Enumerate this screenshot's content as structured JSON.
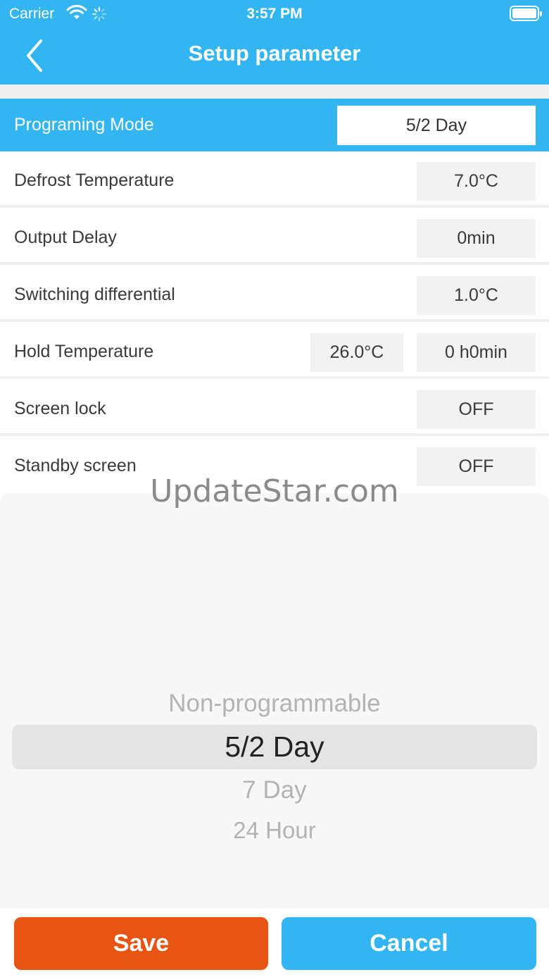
{
  "status_bar": {
    "carrier": "Carrier",
    "time": "3:57 PM",
    "icons": [
      "wifi-icon",
      "activity-spinner-icon",
      "battery-icon"
    ]
  },
  "nav": {
    "title": "Setup parameter",
    "back_icon": "chevron-left-icon"
  },
  "rows": [
    {
      "label": "Programing Mode",
      "values": [
        "5/2 Day"
      ]
    },
    {
      "label": "Defrost Temperature",
      "values": [
        "7.0°C"
      ]
    },
    {
      "label": "Output Delay",
      "values": [
        "0min"
      ]
    },
    {
      "label": "Switching differential",
      "values": [
        "1.0°C"
      ]
    },
    {
      "label": "Hold Temperature",
      "values": [
        "26.0°C",
        "0 h0min"
      ]
    },
    {
      "label": "Screen lock",
      "values": [
        "OFF"
      ]
    },
    {
      "label": "Standby screen",
      "values": [
        "OFF"
      ]
    }
  ],
  "watermark": "UpdateStar.com",
  "picker": {
    "options": [
      "Non-programmable",
      "5/2 Day",
      "7 Day",
      "24 Hour"
    ],
    "selected": "5/2 Day"
  },
  "buttons": {
    "save": "Save",
    "cancel": "Cancel"
  },
  "colors": {
    "primary": "#33b5f2",
    "save": "#e85412"
  }
}
